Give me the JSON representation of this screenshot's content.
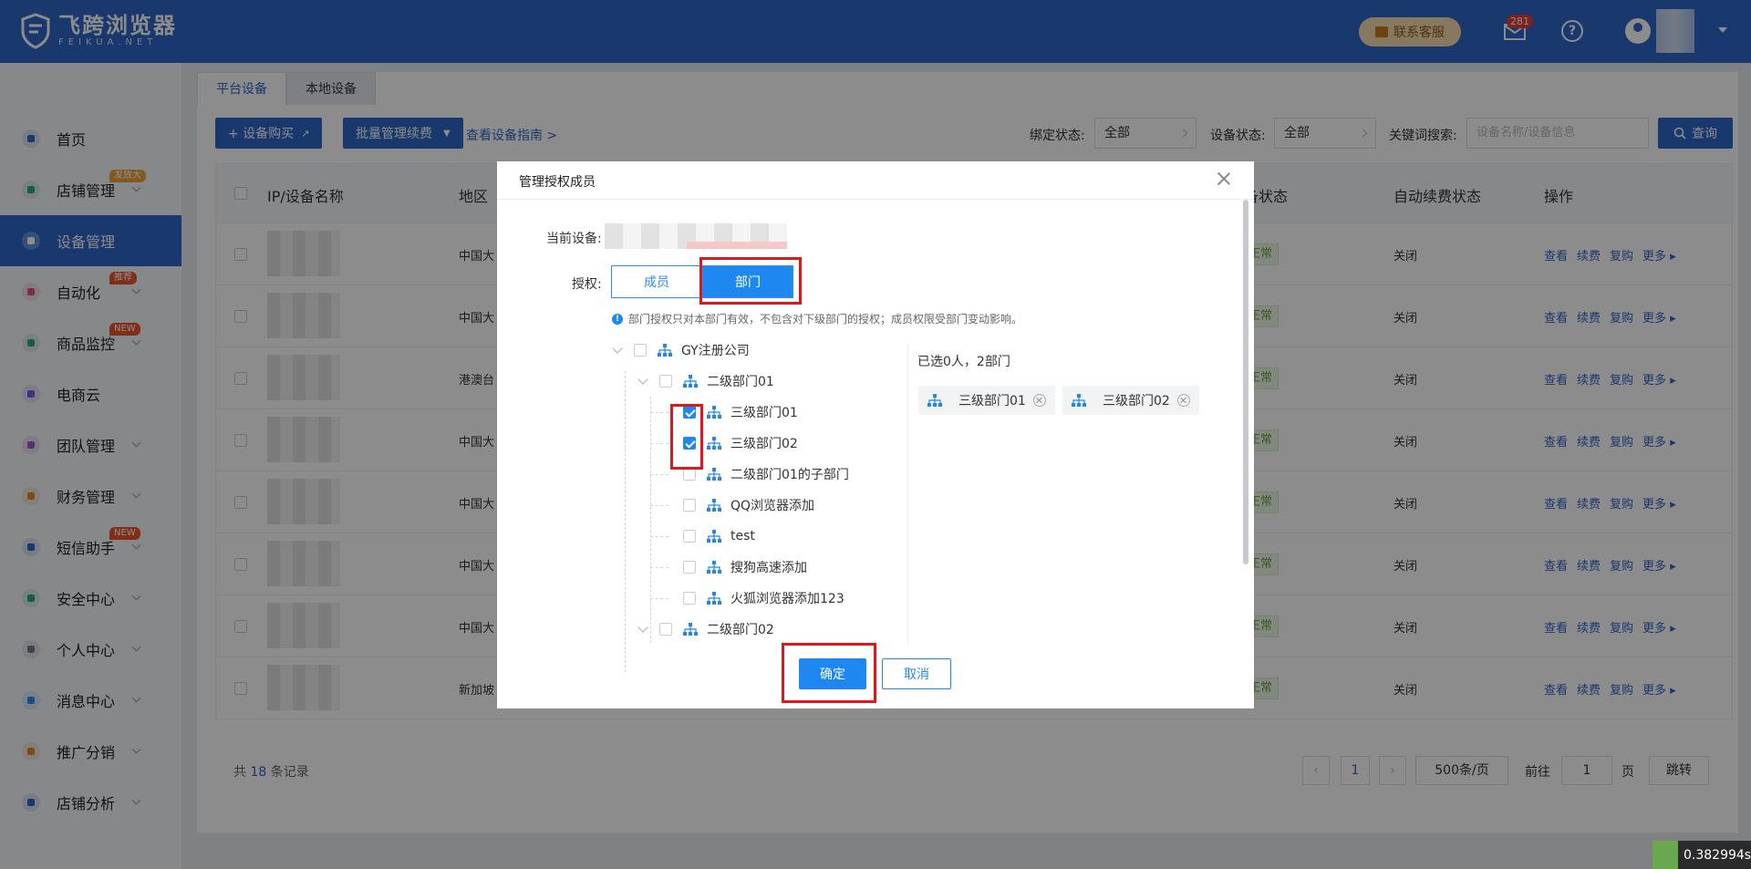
{
  "app": {
    "logo_cn": "飞跨浏览器",
    "logo_en": "FEIKUA.NET",
    "contact_label": "联系客服",
    "mail_count": "281"
  },
  "sidebar": {
    "items": [
      {
        "label": "首页",
        "color": "#2f66c7"
      },
      {
        "label": "店铺管理",
        "badge": "发放大",
        "color": "#2aa87a"
      },
      {
        "label": "设备管理",
        "active": true,
        "color": "#ffffff"
      },
      {
        "label": "自动化",
        "badge": "推荐",
        "color": "#e05a7a"
      },
      {
        "label": "商品监控",
        "badge": "NEW",
        "color": "#2aa87a"
      },
      {
        "label": "电商云",
        "color": "#7a5ae0"
      },
      {
        "label": "团队管理",
        "color": "#a05ad8"
      },
      {
        "label": "财务管理",
        "color": "#e08a2a"
      },
      {
        "label": "短信助手",
        "badge": "NEW",
        "color": "#2f66c7"
      },
      {
        "label": "安全中心",
        "color": "#2aa87a"
      },
      {
        "label": "个人中心",
        "color": "#7a7a8a"
      },
      {
        "label": "消息中心",
        "color": "#2f8df5"
      },
      {
        "label": "推广分销",
        "color": "#e08a2a"
      },
      {
        "label": "店铺分析",
        "color": "#2f66c7"
      }
    ]
  },
  "tabs": [
    "平台设备",
    "本地设备"
  ],
  "toolbar": {
    "buy_label": "+ 设备购买",
    "batch_label": "批量管理续费",
    "guide_label": "查看设备指南 >",
    "bind_label": "绑定状态:",
    "bind_value": "全部",
    "device_status_label": "设备状态:",
    "device_status_value": "全部",
    "keyword_label": "关键词搜索:",
    "keyword_placeholder": "设备名称/设备信息",
    "query_label": "查询"
  },
  "table": {
    "headers": [
      "IP/设备名称",
      "地区",
      "备状态",
      "自动续费状态",
      "操作"
    ],
    "rows": [
      {
        "region": "中国大",
        "status": "正常",
        "renew": "关闭"
      },
      {
        "region": "中国大",
        "status": "正常",
        "renew": "关闭"
      },
      {
        "region": "港澳台",
        "status": "正常",
        "renew": "关闭"
      },
      {
        "region": "中国大",
        "status": "正常",
        "renew": "关闭"
      },
      {
        "region": "中国大",
        "status": "正常",
        "renew": "关闭"
      },
      {
        "region": "中国大",
        "status": "正常",
        "renew": "关闭"
      },
      {
        "region": "中国大",
        "status": "正常",
        "renew": "关闭"
      },
      {
        "region": "新加坡",
        "status": "正常",
        "renew": "关闭"
      }
    ],
    "ops": [
      "查看",
      "续费",
      "复购",
      "更多"
    ]
  },
  "pager": {
    "total_prefix": "共",
    "total": "18",
    "total_suffix": "条记录",
    "page": "1",
    "page_size": "500条/页",
    "goto_label": "前往",
    "goto_value": "1",
    "page_unit": "页",
    "jump_label": "跳转"
  },
  "modal": {
    "title": "管理授权成员",
    "current_device_label": "当前设备:",
    "auth_label": "授权:",
    "seg_member": "成员",
    "seg_dept": "部门",
    "hint": "部门授权只对本部门有效，不包含对下级部门的授权；成员权限受部门变动影响。",
    "tree": [
      {
        "label": "GY注册公司",
        "level": 0,
        "checked": false,
        "expand": true
      },
      {
        "label": "二级部门01",
        "level": 1,
        "checked": false,
        "expand": true
      },
      {
        "label": "三级部门01",
        "level": 2,
        "checked": true
      },
      {
        "label": "三级部门02",
        "level": 2,
        "checked": true
      },
      {
        "label": "二级部门01的子部门",
        "level": 2,
        "checked": false
      },
      {
        "label": "QQ浏览器添加",
        "level": 2,
        "checked": false
      },
      {
        "label": "test",
        "level": 2,
        "checked": false
      },
      {
        "label": "搜狗高速添加",
        "level": 2,
        "checked": false
      },
      {
        "label": "火狐浏览器添加123",
        "level": 2,
        "checked": false
      },
      {
        "label": "二级部门02",
        "level": 1,
        "checked": false,
        "expand": true
      }
    ],
    "selected_summary": "已选0人，2部门",
    "chips": [
      "三级部门01",
      "三级部门02"
    ],
    "ok_label": "确定",
    "cancel_label": "取消"
  },
  "timer": "0.382994s"
}
